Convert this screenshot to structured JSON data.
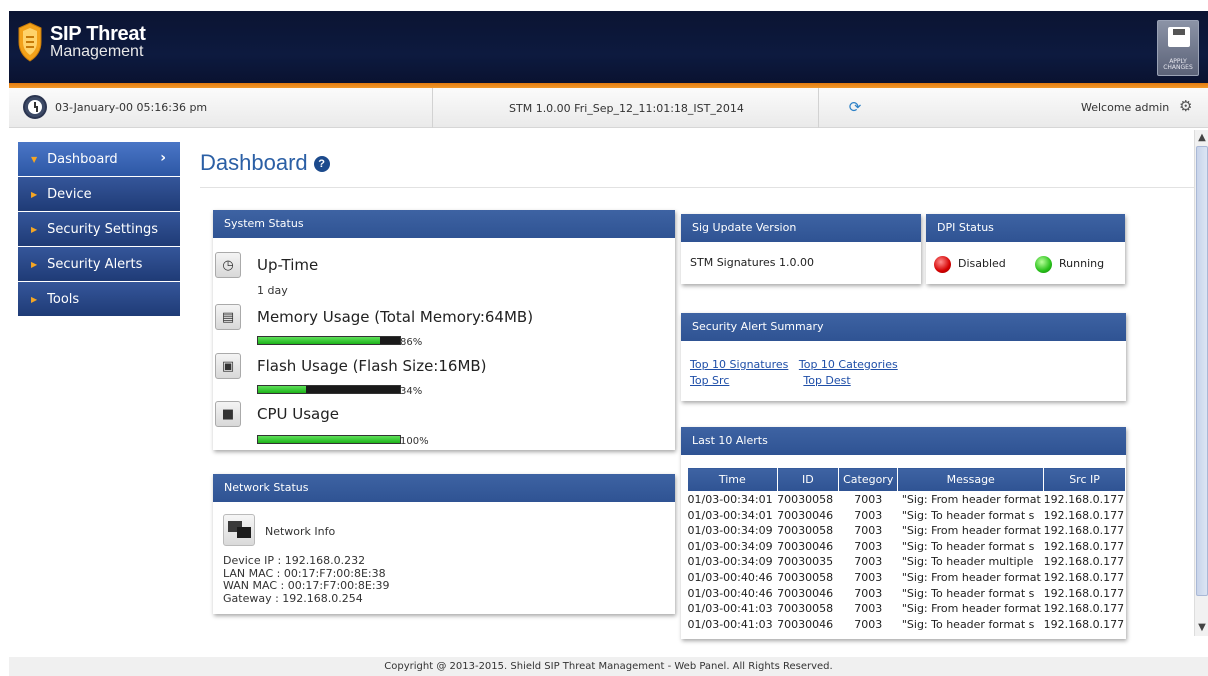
{
  "header": {
    "logo_line1": "SIP Threat",
    "logo_line2": "Management",
    "apply_label": "APPLY\nCHANGES",
    "brand_color": "#0d1a3f",
    "accent_color": "#f39a2c"
  },
  "infobar": {
    "datetime": "03-January-00  05:16:36 pm",
    "version": "STM 1.0.00 Fri_Sep_12_11:01:18_IST_2014",
    "welcome": "Welcome admin"
  },
  "sidebar": {
    "items": [
      {
        "label": "Dashboard"
      },
      {
        "label": "Device"
      },
      {
        "label": "Security Settings"
      },
      {
        "label": "Security Alerts"
      },
      {
        "label": "Tools"
      }
    ]
  },
  "page": {
    "title": "Dashboard"
  },
  "system_status": {
    "title": "System Status",
    "uptime_title": "Up-Time",
    "uptime_value": "1 day",
    "memory_title": "Memory Usage (Total Memory:64MB)",
    "memory_pct_label": "86%",
    "memory_level": 0.86,
    "flash_title": "Flash Usage (Flash Size:16MB)",
    "flash_pct_label": "34%",
    "flash_level": 0.34,
    "cpu_title": "CPU Usage",
    "cpu_pct_label": "100%",
    "cpu_level": 1.0
  },
  "network_status": {
    "title": "Network Status",
    "info_label": "Network Info",
    "lines": [
      "Device IP : 192.168.0.232",
      "LAN MAC : 00:17:F7:00:8E:38",
      "WAN MAC : 00:17:F7:00:8E:39",
      "Gateway : 192.168.0.254"
    ]
  },
  "sig_update": {
    "title": "Sig Update Version",
    "value": "STM Signatures 1.0.00"
  },
  "dpi_status": {
    "title": "DPI Status",
    "disabled_label": "Disabled",
    "running_label": "Running"
  },
  "alert_summary": {
    "title": "Security Alert Summary",
    "links": [
      "Top 10 Signatures",
      "Top 10 Categories",
      "Top Src",
      "Top Dest"
    ]
  },
  "last_alerts": {
    "title": "Last 10 Alerts",
    "columns": [
      "Time",
      "ID",
      "Category",
      "Message",
      "Src IP"
    ],
    "rows": [
      [
        "01/03-00:34:01",
        "70030058",
        "7003",
        "\"Sig: From header format",
        "192.168.0.177"
      ],
      [
        "01/03-00:34:01",
        "70030046",
        "7003",
        "\"Sig: To header format s",
        "192.168.0.177"
      ],
      [
        "01/03-00:34:09",
        "70030058",
        "7003",
        "\"Sig: From header format",
        "192.168.0.177"
      ],
      [
        "01/03-00:34:09",
        "70030046",
        "7003",
        "\"Sig: To header format s",
        "192.168.0.177"
      ],
      [
        "01/03-00:34:09",
        "70030035",
        "7003",
        "\"Sig: To header multiple",
        "192.168.0.177"
      ],
      [
        "01/03-00:40:46",
        "70030058",
        "7003",
        "\"Sig: From header format",
        "192.168.0.177"
      ],
      [
        "01/03-00:40:46",
        "70030046",
        "7003",
        "\"Sig: To header format s",
        "192.168.0.177"
      ],
      [
        "01/03-00:41:03",
        "70030058",
        "7003",
        "\"Sig: From header format",
        "192.168.0.177"
      ],
      [
        "01/03-00:41:03",
        "70030046",
        "7003",
        "\"Sig: To header format s",
        "192.168.0.177"
      ]
    ]
  },
  "footer": {
    "text": "Copyright @ 2013-2015. Shield SIP Threat Management - Web Panel. All Rights Reserved."
  }
}
